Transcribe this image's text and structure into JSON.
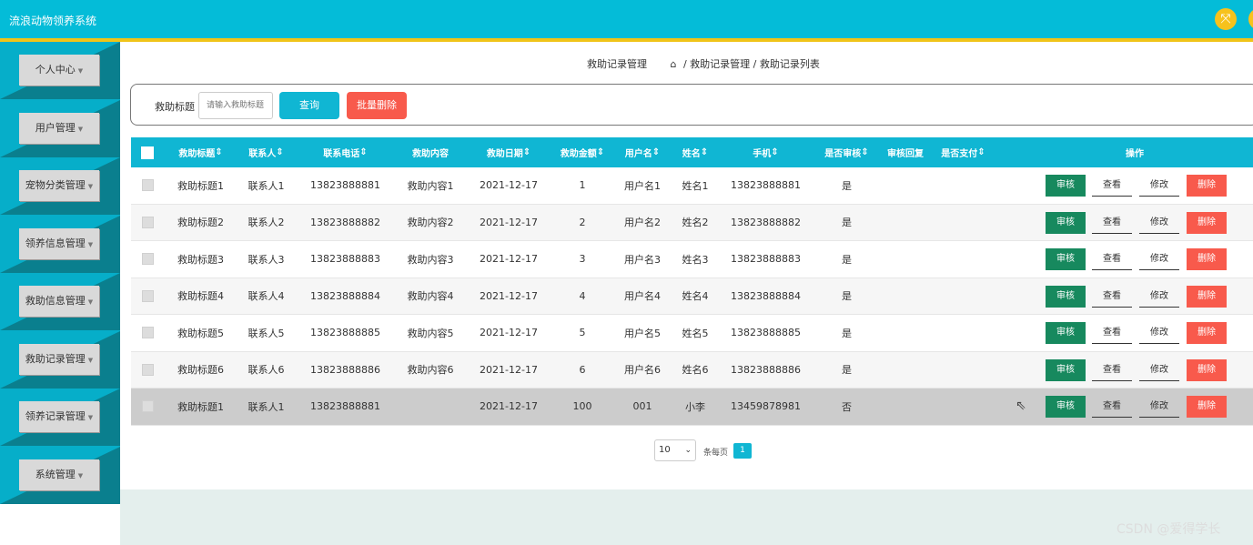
{
  "app": {
    "title": "流浪动物领养系统"
  },
  "header": {
    "icon": "fullscreen-icon"
  },
  "sidebar": {
    "items": [
      {
        "label": "个人中心"
      },
      {
        "label": "用户管理"
      },
      {
        "label": "宠物分类管理"
      },
      {
        "label": "领养信息管理"
      },
      {
        "label": "救助信息管理"
      },
      {
        "label": "救助记录管理"
      },
      {
        "label": "领养记录管理"
      },
      {
        "label": "系统管理"
      }
    ]
  },
  "breadcrumb": {
    "page_title": "救助记录管理",
    "path": "/ 救助记录管理 / 救助记录列表"
  },
  "search": {
    "label": "救助标题",
    "placeholder": "请输入救助标题",
    "query_button": "查询",
    "bulk_delete_button": "批量删除"
  },
  "table": {
    "headers": [
      "救助标题",
      "联系人",
      "联系电话",
      "救助内容",
      "救助日期",
      "救助金额",
      "用户名",
      "姓名",
      "手机",
      "是否审核",
      "审核回复",
      "是否支付",
      "操作"
    ],
    "sortable_mark": "⇕",
    "actions": {
      "approve": "审核",
      "view": "查看",
      "edit": "修改",
      "delete": "删除"
    },
    "rows": [
      [
        "救助标题1",
        "联系人1",
        "13823888881",
        "救助内容1",
        "2021-12-17",
        "1",
        "用户名1",
        "姓名1",
        "13823888881",
        "是",
        "",
        ""
      ],
      [
        "救助标题2",
        "联系人2",
        "13823888882",
        "救助内容2",
        "2021-12-17",
        "2",
        "用户名2",
        "姓名2",
        "13823888882",
        "是",
        "",
        ""
      ],
      [
        "救助标题3",
        "联系人3",
        "13823888883",
        "救助内容3",
        "2021-12-17",
        "3",
        "用户名3",
        "姓名3",
        "13823888883",
        "是",
        "",
        ""
      ],
      [
        "救助标题4",
        "联系人4",
        "13823888884",
        "救助内容4",
        "2021-12-17",
        "4",
        "用户名4",
        "姓名4",
        "13823888884",
        "是",
        "",
        ""
      ],
      [
        "救助标题5",
        "联系人5",
        "13823888885",
        "救助内容5",
        "2021-12-17",
        "5",
        "用户名5",
        "姓名5",
        "13823888885",
        "是",
        "",
        ""
      ],
      [
        "救助标题6",
        "联系人6",
        "13823888886",
        "救助内容6",
        "2021-12-17",
        "6",
        "用户名6",
        "姓名6",
        "13823888886",
        "是",
        "",
        ""
      ],
      [
        "救助标题1",
        "联系人1",
        "13823888881",
        "",
        "2021-12-17",
        "100",
        "001",
        "小李",
        "13459878981",
        "否",
        "",
        ""
      ]
    ]
  },
  "pagination": {
    "page_size": "10",
    "per_page_label": "条每页",
    "current_page": "1"
  },
  "watermark": "CSDN @爱得学长",
  "colors": {
    "accent": "#10b6d3",
    "danger": "#f85a4c",
    "approve": "#17895e",
    "header_border": "#f0c419"
  }
}
